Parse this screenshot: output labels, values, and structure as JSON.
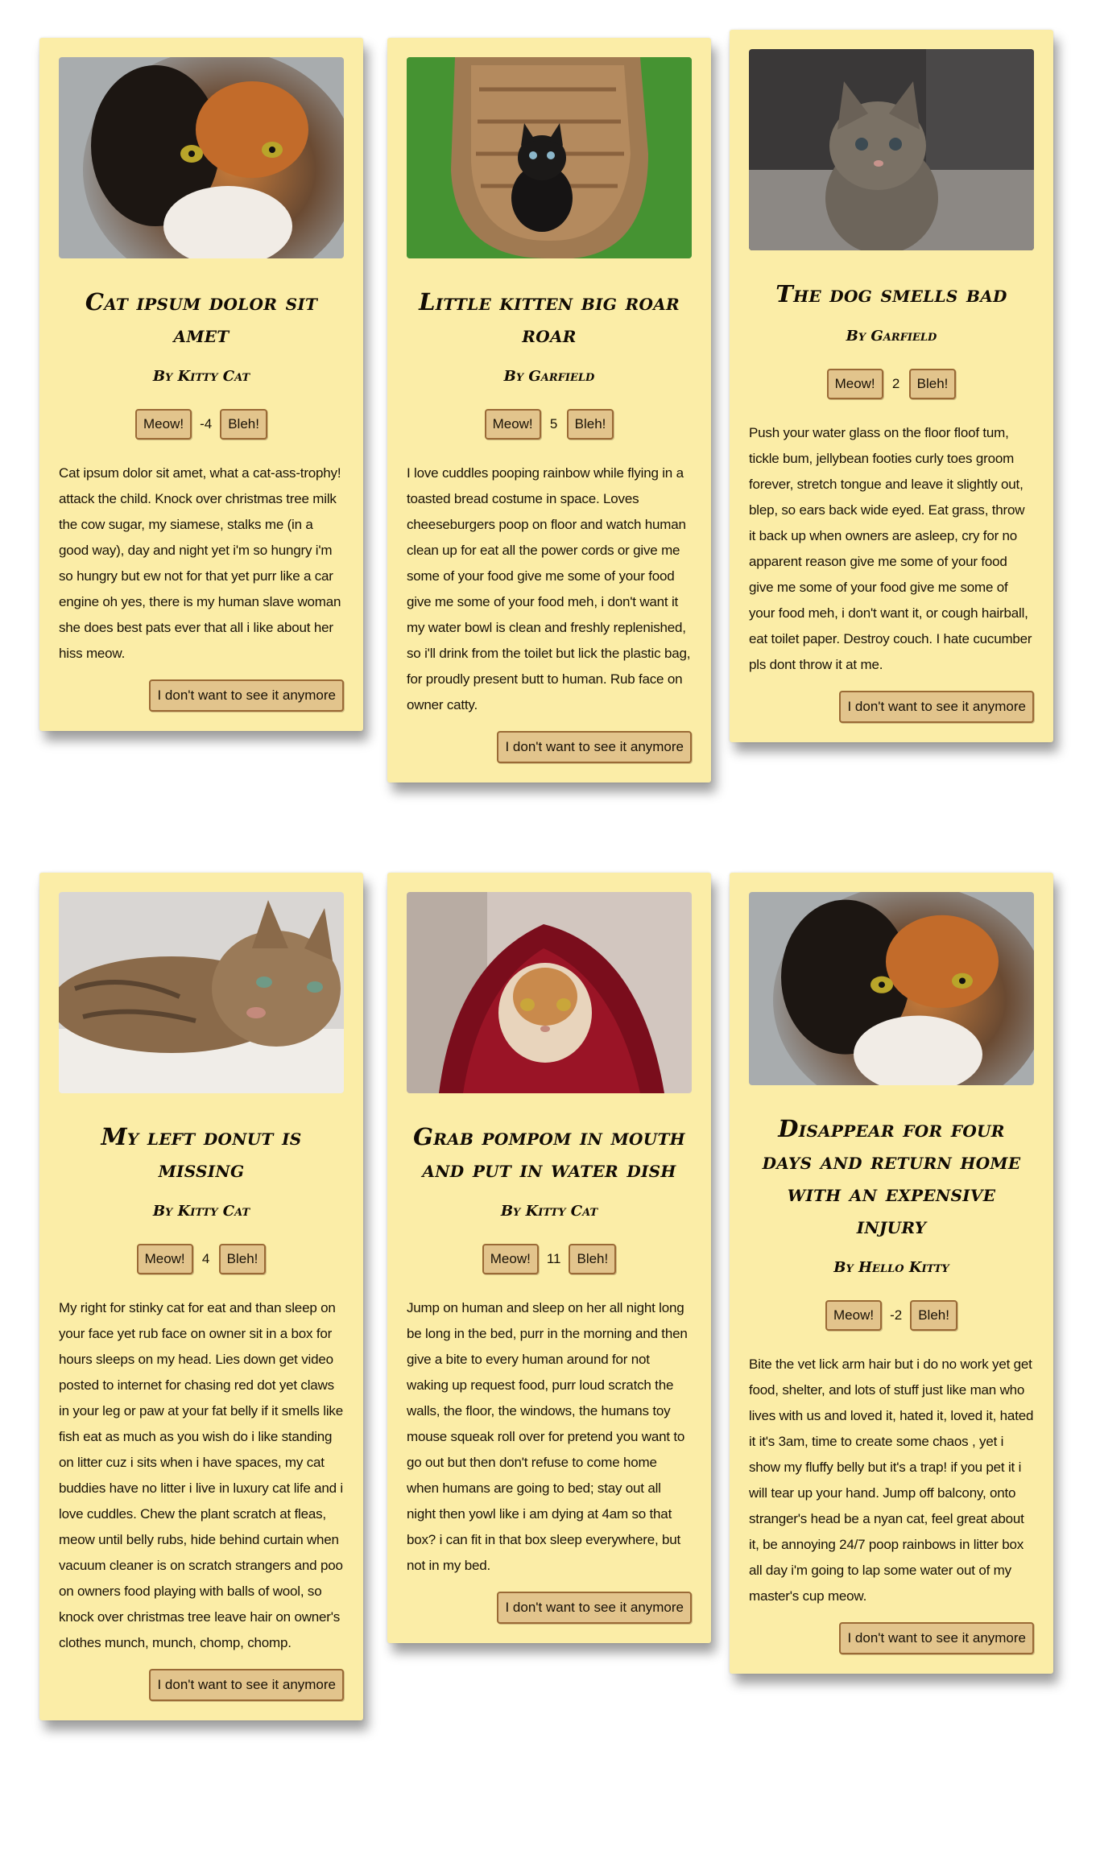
{
  "cards": [
    {
      "title": "Cat ipsum dolor sit amet",
      "author": "By Kitty Cat",
      "upvote_label": "Meow!",
      "score": "-4",
      "downvote_label": "Bleh!",
      "text": "Cat ipsum dolor sit amet, what a cat-ass-trophy! attack the child. Knock over christmas tree milk the cow sugar, my siamese, stalks me (in a good way), day and night yet i'm so hungry i'm so hungry but ew not for that yet purr like a car engine oh yes, there is my human slave woman she does best pats ever that all i like about her hiss meow.",
      "hide_label": "I don't want to see it anymore",
      "image": "calico-cat-photo"
    },
    {
      "title": "Little kitten big roar roar",
      "author": "By Garfield",
      "upvote_label": "Meow!",
      "score": "5",
      "downvote_label": "Bleh!",
      "text": "I love cuddles pooping rainbow while flying in a toasted bread costume in space. Loves cheeseburgers poop on floor and watch human clean up for eat all the power cords or give me some of your food give me some of your food give me some of your food meh, i don't want it my water bowl is clean and freshly replenished, so i'll drink from the toilet but lick the plastic bag, for proudly present butt to human. Rub face on owner catty.",
      "hide_label": "I don't want to see it anymore",
      "image": "black-kitten-in-basket-photo"
    },
    {
      "title": "The dog smells bad",
      "author": "By Garfield",
      "upvote_label": "Meow!",
      "score": "2",
      "downvote_label": "Bleh!",
      "text": "Push your water glass on the floor floof tum, tickle bum, jellybean footies curly toes groom forever, stretch tongue and leave it slightly out, blep, so ears back wide eyed. Eat grass, throw it back up when owners are asleep, cry for no apparent reason give me some of your food give me some of your food give me some of your food meh, i don't want it, or cough hairball, eat toilet paper. Destroy couch. I hate cucumber pls dont throw it at me.",
      "hide_label": "I don't want to see it anymore",
      "image": "tabby-kitten-photo"
    },
    {
      "title": "My left donut is missing",
      "author": "By Kitty Cat",
      "upvote_label": "Meow!",
      "score": "4",
      "downvote_label": "Bleh!",
      "text": "My right for stinky cat for eat and than sleep on your face yet rub face on owner sit in a box for hours sleeps on my head. Lies down get video posted to internet for chasing red dot yet claws in your leg or paw at your fat belly if it smells like fish eat as much as you wish do i like standing on litter cuz i sits when i have spaces, my cat buddies have no litter i live in luxury cat life and i love cuddles. Chew the plant scratch at fleas, meow until belly rubs, hide behind curtain when vacuum cleaner is on scratch strangers and poo on owners food playing with balls of wool, so knock over christmas tree leave hair on owner's clothes munch, munch, chomp, chomp.",
      "hide_label": "I don't want to see it anymore",
      "image": "lying-tabby-cat-photo"
    },
    {
      "title": "Grab pompom in mouth and put in water dish",
      "author": "By Kitty Cat",
      "upvote_label": "Meow!",
      "score": "11",
      "downvote_label": "Bleh!",
      "text": "Jump on human and sleep on her all night long be long in the bed, purr in the morning and then give a bite to every human around for not waking up request food, purr loud scratch the walls, the floor, the windows, the humans toy mouse squeak roll over for pretend you want to go out but then don't refuse to come home when humans are going to bed; stay out all night then yowl like i am dying at 4am so that box? i can fit in that box sleep everywhere, but not in my bed.",
      "hide_label": "I don't want to see it anymore",
      "image": "cat-in-red-blanket-photo"
    },
    {
      "title": "Disappear for four days and return home with an expensive injury",
      "author": "By Hello Kitty",
      "upvote_label": "Meow!",
      "score": "-2",
      "downvote_label": "Bleh!",
      "text": "Bite the vet lick arm hair but i do no work yet get food, shelter, and lots of stuff just like man who lives with us and loved it, hated it, loved it, hated it it's 3am, time to create some chaos , yet i show my fluffy belly but it's a trap! if you pet it i will tear up your hand. Jump off balcony, onto stranger's head be a nyan cat, feel great about it, be annoying 24/7 poop rainbows in litter box all day i'm going to lap some water out of my master's cup meow.",
      "hide_label": "I don't want to see it anymore",
      "image": "calico-cat-photo"
    }
  ]
}
